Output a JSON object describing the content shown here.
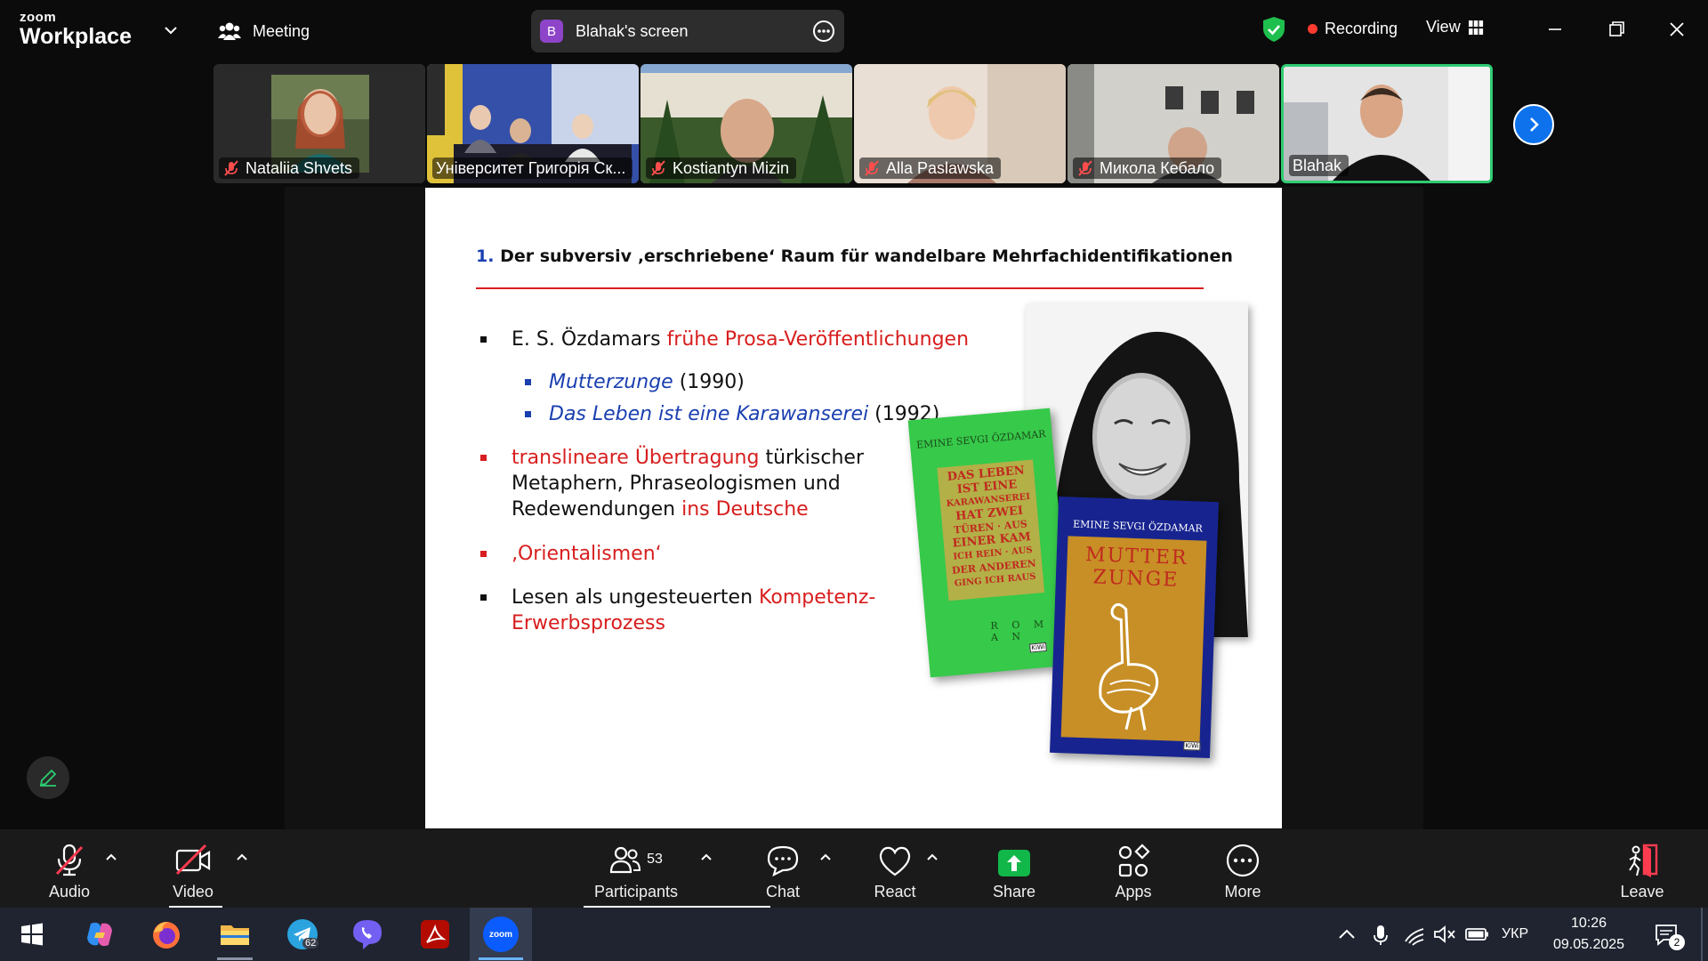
{
  "app": {
    "brand_small": "zoom",
    "brand_big": "Workplace"
  },
  "topbar": {
    "meeting_label": "Meeting",
    "share_avatar_letter": "B",
    "share_label": "Blahak's screen",
    "recording_label": "Recording",
    "view_label": "View"
  },
  "participants": [
    {
      "name": "Nataliia Shvets",
      "muted": true
    },
    {
      "name": "Університет Григорія Ск...",
      "muted": false
    },
    {
      "name": "Kostiantyn Mizin",
      "muted": true
    },
    {
      "name": "Alla Paslawska",
      "muted": true
    },
    {
      "name": "Микола Кебало",
      "muted": true
    },
    {
      "name": "Blahak",
      "muted": false,
      "active": true
    }
  ],
  "slide": {
    "title_num": "1.",
    "title_text": " Der subversiv ‚erschriebene‘ Raum für wandelbare Mehrfachidentifikationen",
    "b1_pre": "E. S. Özdamars ",
    "b1_red": "frühe Prosa-Veröffentlichungen",
    "s1_title": "Mutterzunge",
    "s1_year": " (1990)",
    "s2_title": "Das Leben ist eine Karawanserei",
    "s2_year": " (1992)",
    "b2_red": "translineare Übertragung",
    "b2_rest1": " türkischer",
    "b2_line2": "Metaphern, Phraseologismen und",
    "b2_line3": "Redewendungen ",
    "b2_red2": "ins Deutsche",
    "b3_red": "‚Orientalismen‘",
    "b4_pre": "Lesen als ungesteuerten ",
    "b4_red1": "Kompetenz-",
    "b4_red2": "Erwerbsprozess",
    "book1_author": "EMINE SEVGI ÖZDAMAR",
    "book1_title_lines": [
      "DAS LEBEN",
      "IST EINE",
      "KARAWANSEREI",
      "HAT ZWEI",
      "TÜREN · AUS",
      "EINER KAM",
      "ICH REIN · AUS",
      "DER ANDEREN",
      "GING ICH RAUS"
    ],
    "book1_roman": "R O M A N",
    "book2_author": "EMINE SEVGI ÖZDAMAR",
    "book2_title_1": "MUTTER",
    "book2_title_2": "ZUNGE",
    "publisher": "KiWi"
  },
  "toolbar": {
    "audio": "Audio",
    "video": "Video",
    "participants": "Participants",
    "participants_count": "53",
    "chat": "Chat",
    "react": "React",
    "share": "Share",
    "apps": "Apps",
    "more": "More",
    "leave": "Leave"
  },
  "taskbar": {
    "telegram_badge": "62",
    "zoom_label": "zoom",
    "lang": "УКР",
    "time": "10:26",
    "date": "09.05.2025",
    "notif_count": "2"
  },
  "colors": {
    "accent": "#0e72ed",
    "share_green": "#12b74a",
    "record_red": "#ff3b30",
    "slide_red": "#d81e1e",
    "slide_blue": "#1a3fb0"
  }
}
